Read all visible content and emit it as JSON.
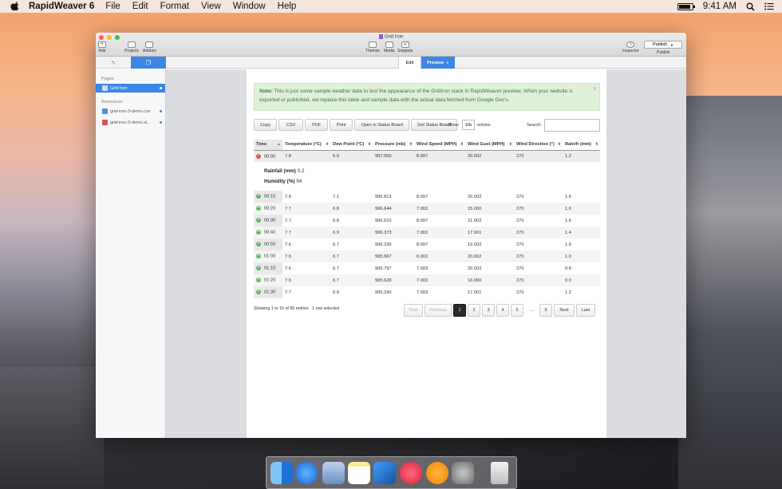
{
  "menubar": {
    "app_name": "RapidWeaver 6",
    "menus": [
      "File",
      "Edit",
      "Format",
      "View",
      "Window",
      "Help"
    ],
    "clock": "9:41 AM"
  },
  "window": {
    "title": "Grid Iron",
    "toolbar": {
      "add": "Add",
      "projects": "Projects",
      "addons": "Addons",
      "themes": "Themes",
      "media": "Media",
      "snippets": "Snippets",
      "inspector": "Inspector",
      "publish_btn": "Publish",
      "publish": "Publish"
    },
    "view_tabs": {
      "edit": "Edit",
      "preview": "Preview"
    },
    "sidebar": {
      "pages_header": "Pages",
      "pages": [
        "Grid Iron"
      ],
      "resources_header": "Resources",
      "resources": [
        "grid-iron-3-demo.csv",
        "grid-iron-3-demo.xl..."
      ]
    }
  },
  "content": {
    "note_bold": "Note:",
    "note_text": "This is just some sample weather data to test the appearance of the GridIron stack in RapidWeaver preview. When your website is exported or published, we replace this table and sample data with the actual data fetched from Google Doc's.",
    "note_close": "×",
    "buttons": [
      "Copy",
      "CSV",
      "PDF",
      "Print",
      "Open in Status Board",
      "Get Status Board"
    ],
    "show_label": "Show",
    "show_value": "10",
    "entries_label": "entries",
    "search_label": "Search:",
    "columns": [
      "Time",
      "Temperature (°C)",
      "Dew Point (°C)",
      "Pressure (mb)",
      "Wind Speed (MPH)",
      "Wind Gust (MPH)",
      "Wind Direction (°)",
      "Rain/h (mm)"
    ],
    "rows": [
      [
        "00:00",
        "7.8",
        "6.9",
        "997.050",
        "8.997",
        "20.002",
        "270",
        "1.2"
      ],
      [
        "00:10",
        "7.8",
        "7.1",
        "996.813",
        "8.997",
        "20.002",
        "270",
        "1.6"
      ],
      [
        "00:20",
        "7.7",
        "6.8",
        "996.644",
        "7.003",
        "15.000",
        "270",
        "1.6"
      ],
      [
        "00:30",
        "7.7",
        "6.8",
        "996.610",
        "8.997",
        "21.002",
        "270",
        "1.6"
      ],
      [
        "00:40",
        "7.7",
        "6.9",
        "996.373",
        "7.003",
        "17.001",
        "270",
        "1.4"
      ],
      [
        "00:50",
        "7.6",
        "6.7",
        "996.236",
        "8.997",
        "19.002",
        "270",
        "1.0"
      ],
      [
        "01:00",
        "7.6",
        "6.7",
        "995.967",
        "6.002",
        "20.002",
        "270",
        "1.0"
      ],
      [
        "01:10",
        "7.6",
        "6.7",
        "995.797",
        "7.003",
        "20.002",
        "270",
        "0.8"
      ],
      [
        "01:20",
        "7.6",
        "6.7",
        "995.628",
        "7.003",
        "16.000",
        "270",
        "0.0"
      ],
      [
        "01:30",
        "7.7",
        "6.9",
        "995.290",
        "7.003",
        "17.001",
        "270",
        "1.2"
      ]
    ],
    "expanded": {
      "rain_label": "Rainfall (mm)",
      "rain_value": "0.2",
      "humidity_label": "Humidity (%)",
      "humidity_value": "94"
    },
    "info": "Showing 1 to 10 of 85 entries",
    "selected": "1 row selected",
    "pager": {
      "first": "First",
      "previous": "Previous",
      "pages": [
        "1",
        "2",
        "3",
        "4",
        "5"
      ],
      "ellipsis": "…",
      "last_page": "9",
      "next": "Next",
      "last": "Last"
    }
  },
  "colors": {
    "accent": "#3e86e6",
    "note_bg": "#dff0d8",
    "note_text": "#3c763d",
    "expand_open": "#d9534f",
    "expand_closed": "#5cb85c"
  }
}
